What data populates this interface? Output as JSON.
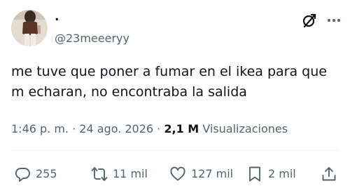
{
  "author": {
    "display_name": ".",
    "handle": "@23meeeryy"
  },
  "tweet": {
    "text_line1": "me tuve que poner a fumar en el ikea para que",
    "text_line2": "m echaran, no encontraba la salida"
  },
  "meta": {
    "time": "1:46 p. m.",
    "separator": " · ",
    "date": "24 ago. 2026",
    "separator2": " · ",
    "views_count": "2,1 M",
    "views_label": " Visualizaciones"
  },
  "actions": {
    "replies": "255",
    "reposts": "11 mil",
    "likes": "127 mil",
    "bookmarks": "2 mil"
  },
  "icons": {
    "grok": "grok-icon",
    "more": "more-icon",
    "reply": "reply-icon",
    "repost": "repost-icon",
    "like": "heart-icon",
    "bookmark": "bookmark-icon",
    "share": "share-icon"
  },
  "colors": {
    "text_primary": "#0f1419",
    "text_secondary": "#536471",
    "divider": "#eff3f4"
  }
}
